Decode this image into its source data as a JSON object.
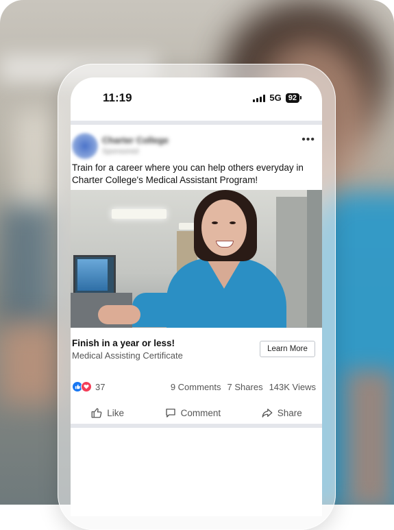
{
  "status_bar": {
    "time": "11:19",
    "network": "5G",
    "battery": "92"
  },
  "post": {
    "page_name": "Charter College",
    "sponsored": "Sponsored",
    "more_label": "•••",
    "text": "Train for a career where you can help others everyday in Charter College's Medical Assistant Program!",
    "cta": {
      "headline": "Finish in a year or less!",
      "subtitle": "Medical Assisting Certificate",
      "button": "Learn More"
    },
    "stats": {
      "reaction_count": "37",
      "comments": "9 Comments",
      "shares": "7 Shares",
      "views": "143K Views"
    },
    "actions": {
      "like": "Like",
      "comment": "Comment",
      "share": "Share"
    }
  },
  "colors": {
    "like_blue": "#1877f2",
    "love_red": "#f33e58",
    "scrubs_blue": "#2b8fc4",
    "separator": "#e4e6eb"
  },
  "icons": [
    "signal-icon",
    "battery-icon",
    "more-icon",
    "like-reaction-icon",
    "love-reaction-icon",
    "thumbs-up-icon",
    "comment-icon",
    "share-icon"
  ]
}
